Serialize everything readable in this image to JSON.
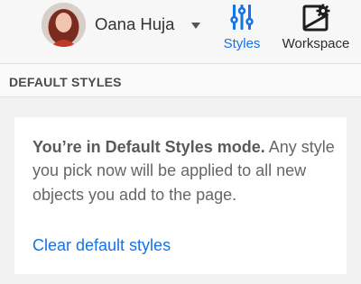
{
  "user": {
    "name": "Oana Huja",
    "avatar_icon": "user-avatar-photo"
  },
  "toolbar": {
    "styles_label": "Styles",
    "styles_icon": "sliders-icon",
    "workspace_label": "Workspace",
    "workspace_icon": "workspace-gear-icon"
  },
  "section": {
    "title": "DEFAULT STYLES"
  },
  "info_card": {
    "heading": "You’re in Default Styles mode.",
    "body": "Any style you pick now will be applied to all new objects you add to the page.",
    "link_label": "Clear default styles"
  },
  "colors": {
    "accent": "#1473e6",
    "text": "#666666",
    "background": "#f2f2f2"
  }
}
